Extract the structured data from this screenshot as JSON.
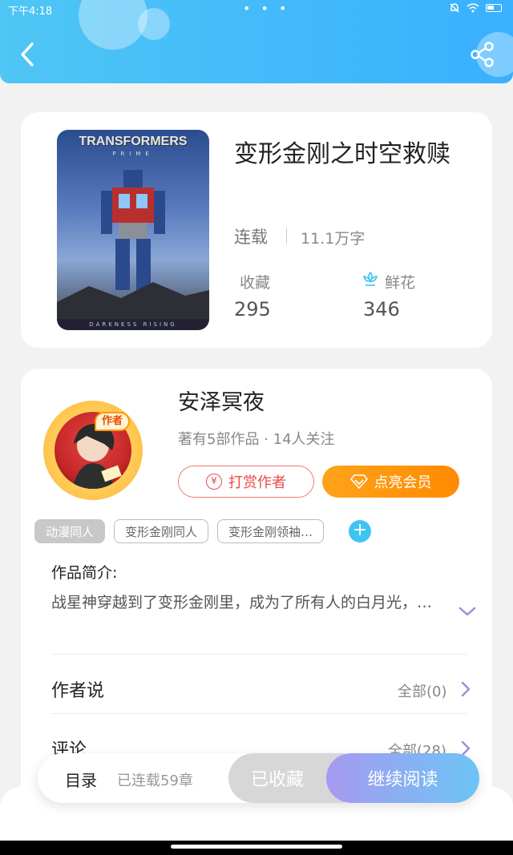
{
  "status_bar": {
    "time": "下午4:18",
    "dots": "• • •"
  },
  "header": {
    "back_icon": "chevron-left-icon",
    "share_icon": "share-icon"
  },
  "book": {
    "cover_title": "TRANSFORMERS",
    "cover_subtitle": "PRIME",
    "cover_bottom": "DARKNESS RISING",
    "title": "变形金刚之时空救赎",
    "status": "连载",
    "word_count": "11.1万字",
    "favorites_label": "收藏",
    "favorites_value": "295",
    "flowers_label": "鲜花",
    "flowers_value": "346"
  },
  "author": {
    "badge": "作者",
    "name": "安泽冥夜",
    "meta": "著有5部作品 · 14人关注",
    "tip_label": "打赏作者",
    "tip_icon": "¥",
    "vip_label": "点亮会员"
  },
  "tags": [
    "动漫同人",
    "变形金刚同人",
    "变形金刚领袖…"
  ],
  "tag_add": "+",
  "intro": {
    "label": "作品简介:",
    "text": "战星神穿越到了变形金刚里，成为了所有人的白月光，…"
  },
  "author_says": {
    "label": "作者说",
    "value": "全部(0)"
  },
  "comments": {
    "label": "评论",
    "value": "全部(28)"
  },
  "bottom_bar": {
    "toc_label": "目录",
    "toc_count": "已连载59章",
    "fav_label": "已收藏",
    "read_label": "继续阅读"
  },
  "colors": {
    "header": "#3ab0ff",
    "accent_orange": "#ff8a00",
    "accent_red": "#e94b4b",
    "accent_purple": "#a79af0",
    "accent_cyan": "#3ec4f4"
  }
}
